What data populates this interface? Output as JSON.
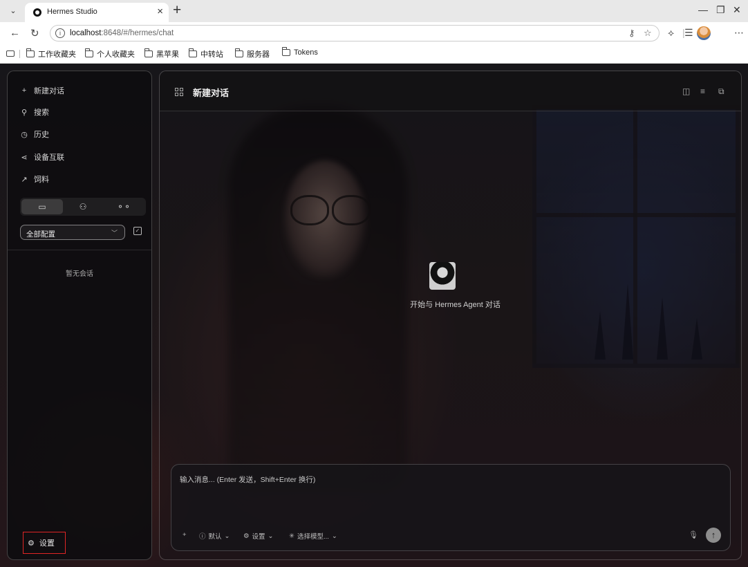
{
  "browser": {
    "tab_title": "Hermes Studio",
    "url_host": "localhost",
    "url_rest": ":8648/#/hermes/chat",
    "bookmarks": [
      "工作收藏夹",
      "个人收藏夹",
      "黑苹果",
      "中转站",
      "服务器",
      "Tokens"
    ]
  },
  "sidebar": {
    "nav": [
      {
        "icon": "plus-icon",
        "label": "新建对话"
      },
      {
        "icon": "search-icon",
        "label": "搜索"
      },
      {
        "icon": "clock-icon",
        "label": "历史"
      },
      {
        "icon": "share-nodes-icon",
        "label": "设备互联"
      },
      {
        "icon": "external-link-icon",
        "label": "饲料"
      }
    ],
    "segment_tabs": [
      "chat-bubble-icon",
      "people-icon",
      "nodes-icon"
    ],
    "profile_select": "全部配置",
    "empty_sessions": "暂无会话",
    "settings_label": "设置"
  },
  "main": {
    "title": "新建对话",
    "welcome": "开始与 Hermes Agent 对话",
    "composer": {
      "placeholder": "输入消息... (Enter 发送，Shift+Enter 换行)",
      "mode_label": "默认",
      "settings_label": "设置",
      "model_label": "选择模型..."
    }
  },
  "colors": {
    "settings_highlight": "#e02525",
    "send_button": "#8d8d8d"
  }
}
